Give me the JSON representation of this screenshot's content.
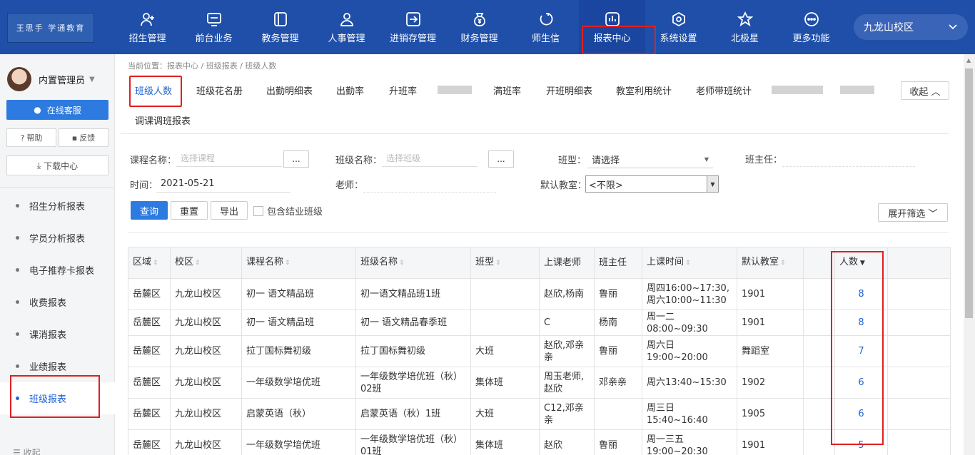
{
  "logo": "王思手 学通教育",
  "campus": "九龙山校区",
  "nav": [
    {
      "label": "招生管理",
      "icon": "person-add-icon"
    },
    {
      "label": "前台业务",
      "icon": "monitor-icon"
    },
    {
      "label": "教务管理",
      "icon": "book-icon"
    },
    {
      "label": "人事管理",
      "icon": "person-icon"
    },
    {
      "label": "进销存管理",
      "icon": "exchange-icon"
    },
    {
      "label": "财务管理",
      "icon": "money-bag-icon"
    },
    {
      "label": "师生信",
      "icon": "chat-icon"
    },
    {
      "label": "报表中心",
      "icon": "chart-icon"
    },
    {
      "label": "系统设置",
      "icon": "gear-icon"
    },
    {
      "label": "北极星",
      "icon": "star-icon"
    },
    {
      "label": "更多功能",
      "icon": "more-icon"
    }
  ],
  "sidebar": {
    "username": "内置管理员",
    "service": "在线客服",
    "help": "帮助",
    "feedback": "反馈",
    "download": "下载中心",
    "items": [
      "招生分析报表",
      "学员分析报表",
      "电子推荐卡报表",
      "收费报表",
      "课消报表",
      "业绩报表",
      "班级报表"
    ],
    "collapse": "收起"
  },
  "breadcrumb": "当前位置：报表中心 / 班级报表 / 班级人数",
  "tabs": [
    "班级人数",
    "班级花名册",
    "出勤明细表",
    "出勤率",
    "升班率",
    "满班率",
    "开班明细表",
    "教室利用统计",
    "老师带班统计",
    "调课调班报表"
  ],
  "collapse_btn": "收起 ︿",
  "filters": {
    "course_label": "课程名称：",
    "course_placeholder": "选择课程",
    "class_label": "班级名称：",
    "class_placeholder": "选择班级",
    "dots": "...",
    "type_label": "班型：",
    "type_value": "请选择",
    "head_label": "班主任：",
    "time_label": "时间：",
    "time_value": "2021-05-21",
    "teacher_label": "老师：",
    "room_label": "默认教室：",
    "room_value": "<不限>"
  },
  "buttons": {
    "query": "查询",
    "reset": "重置",
    "export": "导出",
    "include_finished": "包含结业班级",
    "expand": "展开筛选 ﹀"
  },
  "table": {
    "headers": [
      "区域",
      "校区",
      "课程名称",
      "班级名称",
      "班型",
      "上课老师",
      "班主任",
      "上课时间",
      "默认教室",
      "人数"
    ],
    "rows": [
      [
        "岳麓区",
        "九龙山校区",
        "初一 语文精品班",
        "初一语文精品班1班",
        "",
        "赵欣,杨南",
        "鲁丽",
        "周四16:00~17:30,周六10:00~11:30",
        "1901",
        "8"
      ],
      [
        "岳麓区",
        "九龙山校区",
        "初一 语文精品班",
        "初一 语文精品春季班",
        "",
        "C",
        "杨南",
        "周一二08:00~09:30",
        "1901",
        "8"
      ],
      [
        "岳麓区",
        "九龙山校区",
        "拉丁国标舞初级",
        "拉丁国标舞初级",
        "大班",
        "赵欣,邓亲亲",
        "鲁丽",
        "周六日19:00~20:00",
        "舞蹈室",
        "7"
      ],
      [
        "岳麓区",
        "九龙山校区",
        "一年级数学培优班",
        "一年级数学培优班（秋）02班",
        "集体班",
        "周玉老师,赵欣",
        "邓亲亲",
        "周六13:40~15:30",
        "1902",
        "6"
      ],
      [
        "岳麓区",
        "九龙山校区",
        "启蒙英语（秋）",
        "启蒙英语（秋）1班",
        "大班",
        "C12,邓亲亲",
        "",
        "周三日15:40~16:40",
        "1905",
        "6"
      ],
      [
        "岳麓区",
        "九龙山校区",
        "一年级数学培优班",
        "一年级数学培优班（秋）01班",
        "集体班",
        "赵欣",
        "鲁丽",
        "周一三五19:00~20:30",
        "1901",
        "5"
      ]
    ]
  }
}
